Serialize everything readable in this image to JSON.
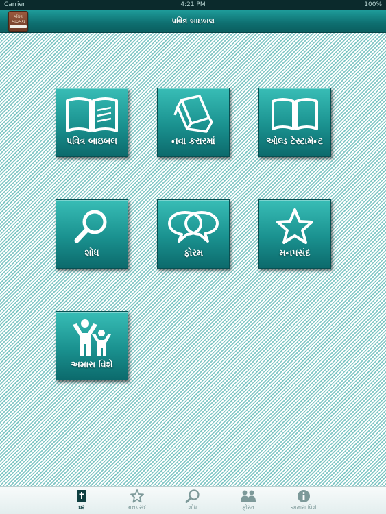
{
  "status_bar": {
    "carrier": "Carrier",
    "time": "4:21 PM",
    "battery": "100%"
  },
  "nav": {
    "title": "પવિત્ર બાઇબલ",
    "logo_line1": "પવિત્ર",
    "logo_line2": "બાઇબલ"
  },
  "tiles": [
    {
      "label": "પવિત્ર બાઇબલ",
      "icon": "open-book-icon"
    },
    {
      "label": "નવા કરારમાં",
      "icon": "stack-of-books-icon"
    },
    {
      "label": "ઓલ્ડ ટેસ્ટામેન્ટ",
      "icon": "open-book-outline-icon"
    },
    {
      "label": "શોધ",
      "icon": "magnifier-icon"
    },
    {
      "label": "ફોરમ",
      "icon": "speech-bubbles-icon"
    },
    {
      "label": "મનપસંદ",
      "icon": "star-icon"
    },
    {
      "label": "અમારા વિશે",
      "icon": "people-icon"
    }
  ],
  "tabs": [
    {
      "label": "ઘર",
      "icon": "bible-icon",
      "active": true
    },
    {
      "label": "મનપસંદ",
      "icon": "star-icon",
      "active": false
    },
    {
      "label": "શોધ",
      "icon": "magnifier-icon",
      "active": false
    },
    {
      "label": "ફોરમ",
      "icon": "people-icon",
      "active": false
    },
    {
      "label": "અમારા વિશે",
      "icon": "info-icon",
      "active": false
    }
  ],
  "colors": {
    "accent": "#1a918f",
    "nav_dark": "#0a5e5f",
    "stripe": "#7fc6c4"
  }
}
